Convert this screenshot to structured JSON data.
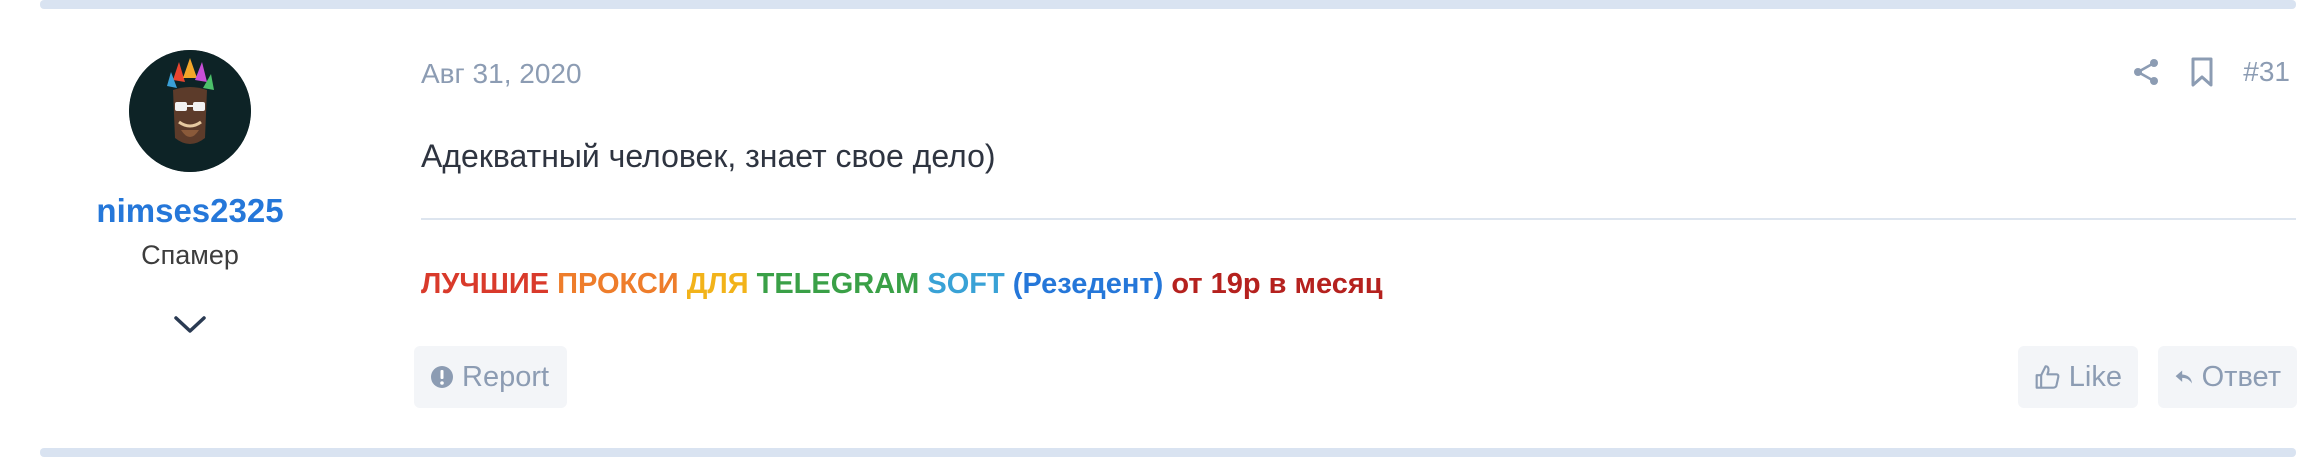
{
  "post": {
    "date": "Авг 31, 2020",
    "number": "#31",
    "message": "Адекватный человек, знает свое дело)",
    "colors": {
      "accent": "#2577d9",
      "muted": "#8c9cb3",
      "bar": "#d9e3f1"
    }
  },
  "user": {
    "name": "nimses2325",
    "title": "Спамер"
  },
  "signature": {
    "parts": [
      {
        "text": "ЛУЧШИЕ",
        "color": "#d93a2b"
      },
      {
        "text": "ПРОКСИ",
        "color": "#ee7d2b"
      },
      {
        "text": "ДЛЯ",
        "color": "#f2b31a"
      },
      {
        "text": "TELEGRAM",
        "color": "#3aa047"
      },
      {
        "text": "SOFT",
        "color": "#39a2d6"
      },
      {
        "text": "(Резедент)",
        "color": "#2577d9"
      },
      {
        "text": "от 19р в месяц",
        "color": "#b5211e"
      }
    ]
  },
  "actions": {
    "report": "Report",
    "like": "Like",
    "reply": "Ответ"
  }
}
